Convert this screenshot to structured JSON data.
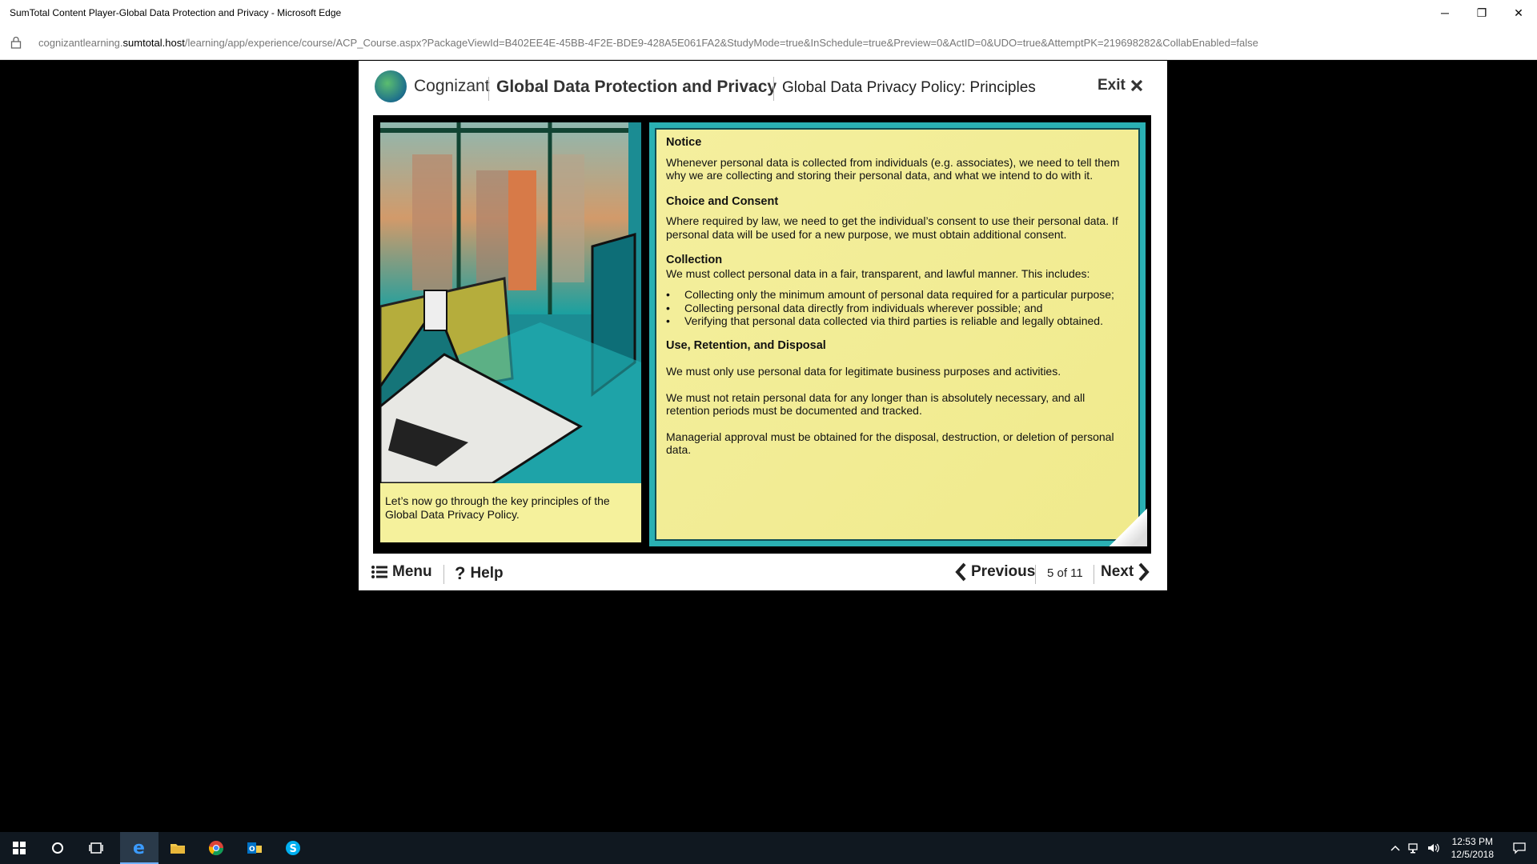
{
  "browser": {
    "window_title": "SumTotal Content Player-Global Data Protection and Privacy - Microsoft Edge",
    "url_prefix": "cognizantlearning.",
    "url_host": "sumtotal.host",
    "url_path": "/learning/app/experience/course/ACP_Course.aspx?PackageViewId=B402EE4E-45BB-4F2E-BDE9-428A5E061FA2&StudyMode=true&InSchedule=true&Preview=0&ActID=0&UDO=true&AttemptPK=219698282&CollabEnabled=false",
    "controls": {
      "minimize": "─",
      "restore": "❐",
      "close": "✕"
    }
  },
  "header": {
    "logo_text": "Cognizant",
    "course_title": "Global Data Protection and Privacy",
    "page_title": "Global Data Privacy Policy: Principles",
    "exit_label": "Exit"
  },
  "caption": "Let’s now go through the key principles of the Global Data Privacy Policy.",
  "content": {
    "notice_heading": "Notice",
    "notice_text": "Whenever personal data is collected from individuals (e.g. associates), we need to tell them why we are collecting and storing their personal data, and what we intend to do with it.",
    "choice_heading": "Choice and Consent",
    "choice_text": "Where required by law, we need to get the individual’s consent to use their personal data. If personal data will be used for a new purpose, we must obtain additional consent.",
    "collection_heading": "Collection",
    "collection_intro": "We must collect personal data in a fair, transparent, and lawful manner. This includes:",
    "collection_items": [
      "Collecting only the minimum amount of personal data required for a particular purpose;",
      "Collecting personal data directly from individuals wherever possible; and",
      "Verifying that personal data collected via third parties is reliable and legally obtained."
    ],
    "use_heading": "Use, Retention, and Disposal",
    "use_text_1": "We must only use personal data for legitimate business purposes and activities.",
    "use_text_2": "We must not retain personal data for any longer than is absolutely necessary, and all retention periods must be documented and tracked.",
    "use_text_3": "Managerial approval must be obtained for the disposal, destruction, or deletion of personal data."
  },
  "footer": {
    "menu_label": "Menu",
    "help_label": "Help",
    "previous_label": "Previous",
    "page_indicator": "5 of 11",
    "next_label": "Next"
  },
  "taskbar": {
    "time": "12:53 PM",
    "date": "12/5/2018",
    "icons": [
      "windows-start-icon",
      "search-circle-icon",
      "task-view-icon",
      "edge-icon",
      "file-explorer-icon",
      "chrome-icon",
      "outlook-icon",
      "skype-icon"
    ]
  },
  "colors": {
    "accent_teal": "#2ab0b3",
    "panel_yellow": "#f4ef9e",
    "taskbar": "#101820"
  }
}
